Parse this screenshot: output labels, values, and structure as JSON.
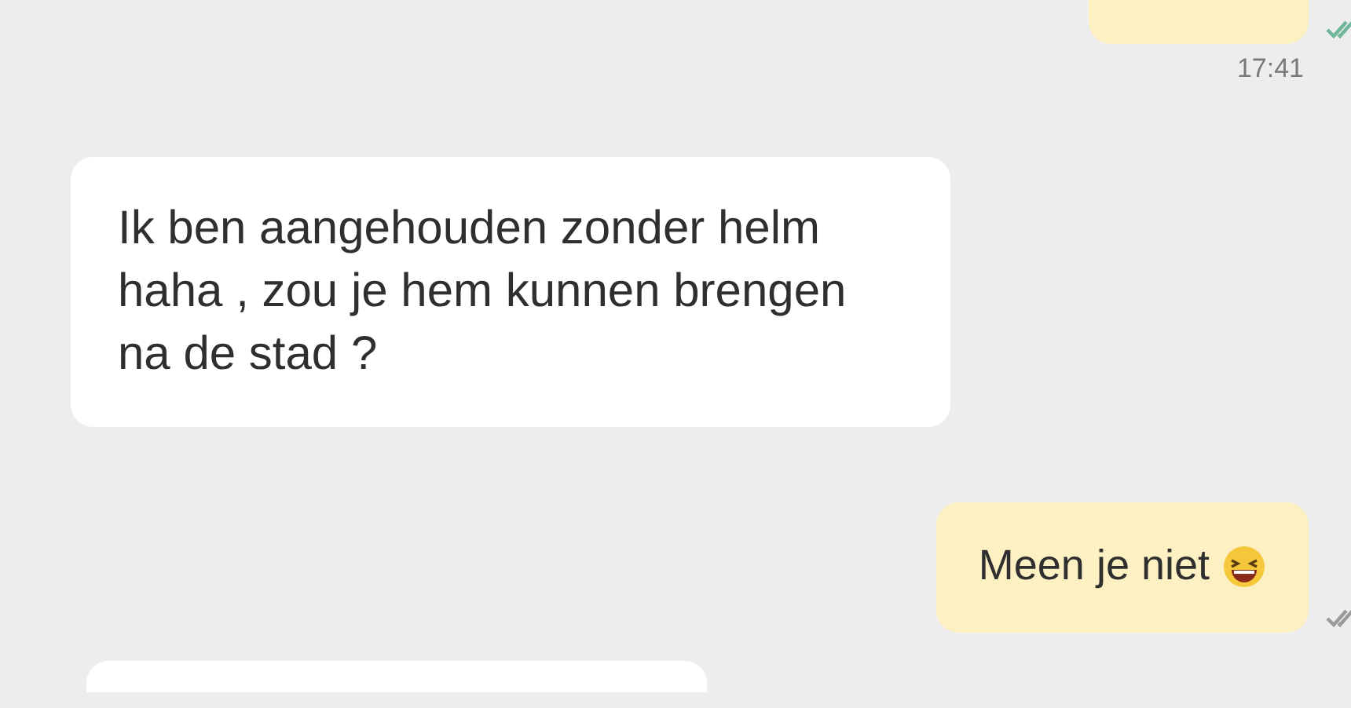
{
  "messages": [
    {
      "kind": "outgoing",
      "read": true,
      "time": "17:41"
    },
    {
      "kind": "incoming",
      "text": "Ik ben aangehouden zonder helm haha , zou je hem kunnen brengen na de stad ?"
    },
    {
      "kind": "outgoing",
      "read": false,
      "text": "Meen je niet",
      "emoji": true
    },
    {
      "kind": "incoming"
    }
  ]
}
